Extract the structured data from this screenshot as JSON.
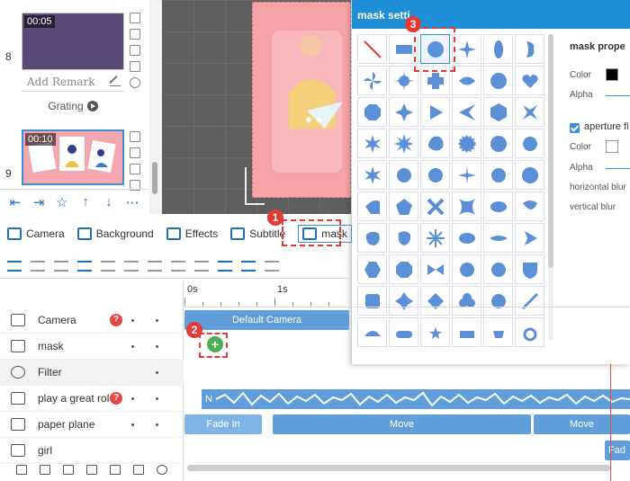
{
  "scenes": [
    {
      "number": "8",
      "time": "00:05",
      "remark_placeholder": "Add Remark",
      "label": "Grating"
    },
    {
      "number": "9",
      "time": "00:10"
    }
  ],
  "toolbar": {
    "items": [
      "Camera",
      "Background",
      "Effects",
      "Subtitle",
      "mask"
    ]
  },
  "mask_panel": {
    "title": "mask setti",
    "properties_title": "mask prope",
    "color_label": "Color",
    "alpha_label": "Alpha",
    "aperture_label": "aperture fi",
    "color2_label": "Color",
    "alpha2_label": "Alpha",
    "horizontal_blur_label": "horizontal blur",
    "vertical_blur_label": "vertical blur",
    "selected_shape": "circle"
  },
  "timeline": {
    "ruler": [
      "0s",
      "1s"
    ],
    "tracks": [
      {
        "name": "Camera",
        "has_help": true,
        "icon": "camera-icon"
      },
      {
        "name": "mask",
        "has_help": false,
        "icon": "mask-icon"
      },
      {
        "name": "Filter",
        "has_help": false,
        "icon": "filter-icon"
      },
      {
        "name": "play a great rol",
        "has_help": true,
        "icon": "music-icon"
      },
      {
        "name": "paper plane",
        "has_help": false,
        "icon": "svg-icon"
      },
      {
        "name": "girl",
        "has_help": false,
        "icon": "image-icon"
      }
    ],
    "camera_bar": "Default Camera",
    "audio_bar_label": "N",
    "plane_bars": [
      "Fade In",
      "Move",
      "Move"
    ],
    "girl_bar": "Fad"
  },
  "callouts": [
    "1",
    "2",
    "3"
  ],
  "colors": {
    "accent": "#1e8fd6",
    "callout": "#e53935",
    "bar": "#5f9edb",
    "canvas_pink": "#f7a4a8"
  }
}
